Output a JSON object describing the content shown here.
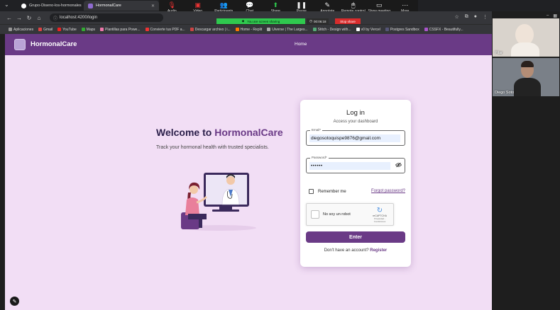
{
  "browser": {
    "tabs": [
      {
        "label": "Grupo-Diseno-los-hormonales"
      },
      {
        "label": "HormonalCare"
      }
    ],
    "url": "localhost:4200/login",
    "bookmarks": [
      "Aplicaciones",
      "Gmail",
      "YouTube",
      "Maps",
      "Plantillas para Powe...",
      "Convierte tus PDF a...",
      "Descargar archivo | i...",
      "Home - Replit",
      "Uiverse | The Larges...",
      "Stitch - Design with...",
      "v0 by Vercel",
      "Postgres Sandbox",
      "CSSFX - Beautifully..."
    ]
  },
  "zoom": {
    "toolbar": [
      {
        "label": "Audio",
        "icon": "mic-muted-icon"
      },
      {
        "label": "Video",
        "icon": "video-icon"
      },
      {
        "label": "Participants",
        "icon": "participants-icon",
        "count": "2"
      },
      {
        "label": "Chat",
        "icon": "chat-icon"
      },
      {
        "label": "Share",
        "icon": "share-icon"
      },
      {
        "label": "Pause",
        "icon": "pause-icon"
      },
      {
        "label": "Annotate",
        "icon": "annotate-icon"
      },
      {
        "label": "Remote control",
        "icon": "remote-control-icon"
      },
      {
        "label": "Show meeting",
        "icon": "show-meeting-icon"
      },
      {
        "label": "More",
        "icon": "more-icon"
      }
    ],
    "share_banner": "You are screen sharing",
    "timer": "00:06:18",
    "stop_share": "Stop share",
    "participants": [
      {
        "name": "Pilar"
      },
      {
        "name": "Diego Soto"
      }
    ]
  },
  "app": {
    "brand": "HormonalCare",
    "nav_home": "Home",
    "hero_title_prefix": "Welcome to ",
    "hero_title_brand": "HormonalCare",
    "hero_subtitle": "Track your hormonal health with trusted specialists."
  },
  "login": {
    "title": "Log in",
    "subtitle": "Access your dashboard",
    "email_label": "Email*",
    "email_value": "diegosotoquispe9876@gmail.com",
    "password_label": "Password*",
    "password_value": "••••••",
    "remember_label": "Remember me",
    "forgot_label": "Forgot password?",
    "captcha_text": "No soy un robot",
    "captcha_brand": "reCAPTCHA",
    "captcha_terms": "Privacidad - Condiciones",
    "enter_label": "Enter",
    "register_prompt": "Don't have an account? ",
    "register_link": "Register"
  },
  "colors": {
    "primary": "#6a3a86",
    "background": "#f2def5",
    "share_green": "#2fc94e",
    "stop_red": "#d82c2c"
  }
}
